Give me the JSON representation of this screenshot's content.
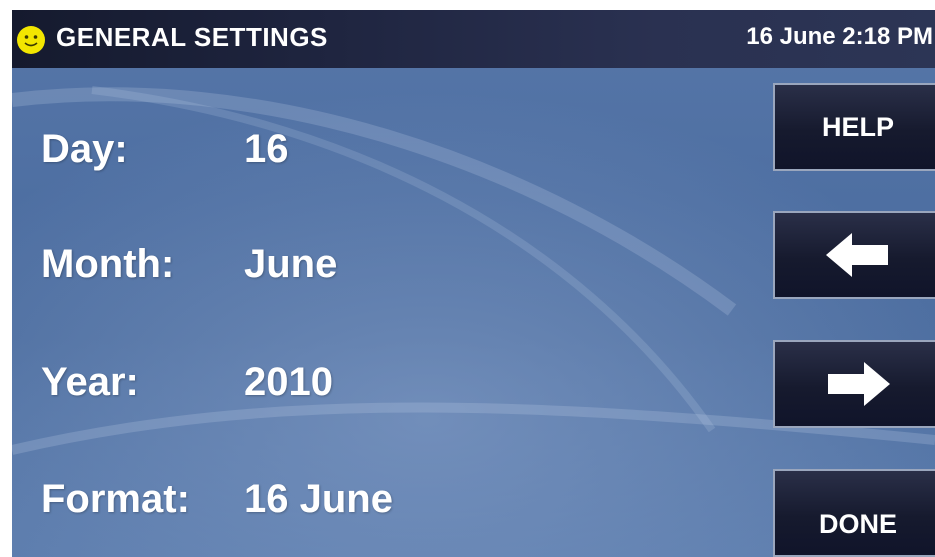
{
  "header": {
    "title": "GENERAL SETTINGS",
    "datetime": "16 June 2:18 PM",
    "status_icon": "smiley-icon"
  },
  "fields": [
    {
      "label": "Day:",
      "value": "16"
    },
    {
      "label": "Month:",
      "value": "June"
    },
    {
      "label": "Year:",
      "value": "2010"
    },
    {
      "label": "Format:",
      "value": "16 June"
    }
  ],
  "buttons": {
    "help_label": "HELP",
    "prev_icon": "arrow-left-icon",
    "next_icon": "arrow-right-icon",
    "done_label": "DONE"
  },
  "colors": {
    "background": "#4e6fa2",
    "topbar": "#1f2540",
    "button": "#161a2e",
    "text": "#ffffff",
    "status_icon": "#f2e600"
  }
}
